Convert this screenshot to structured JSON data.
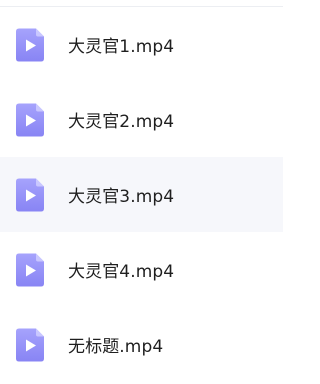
{
  "files": [
    {
      "name": "大灵官1.mp4",
      "icon": "video-file-icon"
    },
    {
      "name": "大灵官2.mp4",
      "icon": "video-file-icon"
    },
    {
      "name": "大灵官3.mp4",
      "icon": "video-file-icon",
      "hovered": true
    },
    {
      "name": "大灵官4.mp4",
      "icon": "video-file-icon"
    },
    {
      "name": "无标题.mp4",
      "icon": "video-file-icon"
    }
  ],
  "colors": {
    "icon_top": "#a3a0fb",
    "icon_bottom": "#8a86f5",
    "icon_fold": "#c9c7ff",
    "hover_bg": "#f6f7fb"
  }
}
